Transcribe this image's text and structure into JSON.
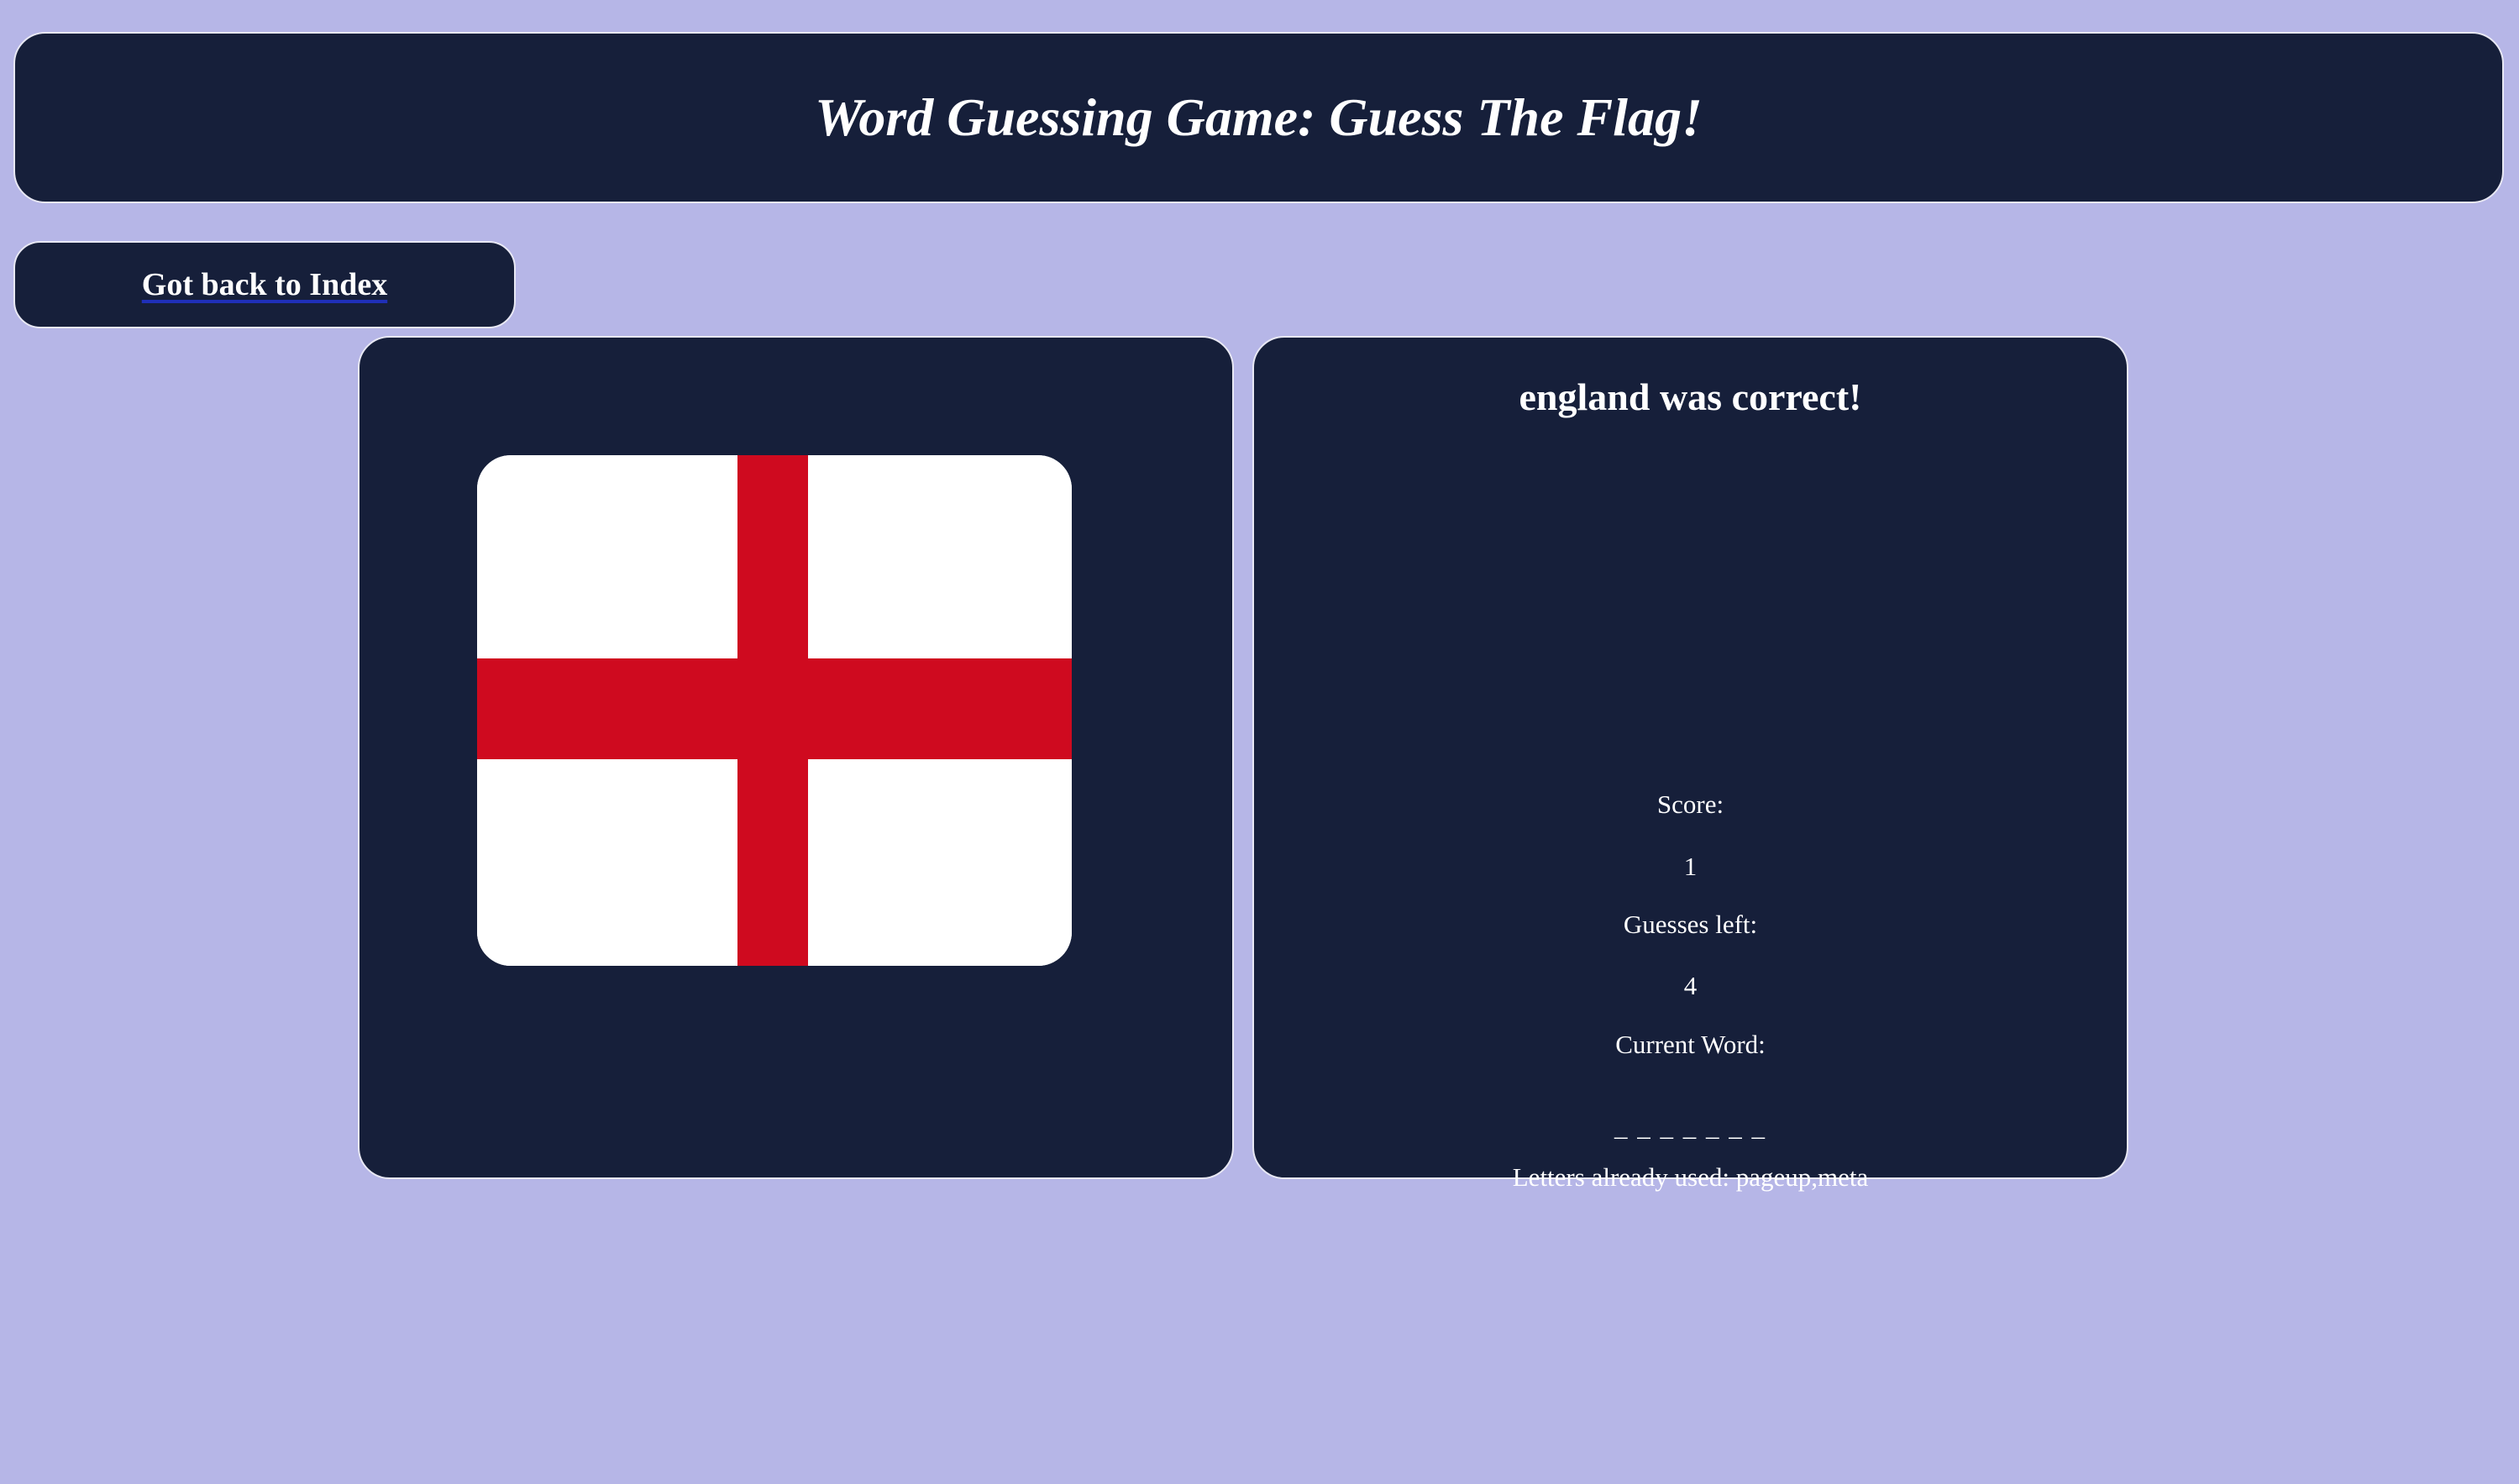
{
  "header": {
    "title": "Word Guessing Game: Guess The Flag!"
  },
  "nav": {
    "back_link_label": "Got back to Index"
  },
  "flag": {
    "name": "england-flag",
    "colors": {
      "field": "#ffffff",
      "cross": "#cf0a1f"
    }
  },
  "game": {
    "result_message": "england was correct!",
    "score_label": "Score:",
    "score_value": "1",
    "guesses_left_label": "Guesses left:",
    "guesses_left_value": "4",
    "current_word_label": "Current Word:",
    "current_word_display": "_ _ _ _ _ _ _",
    "letters_used_text": "Letters already used: pageup,meta"
  },
  "colors": {
    "background": "#b6b6e7",
    "panel": "#161f3a",
    "panel_border": "#e8e8f4",
    "text": "#ffffff",
    "link_underline": "#1f2fb8"
  }
}
